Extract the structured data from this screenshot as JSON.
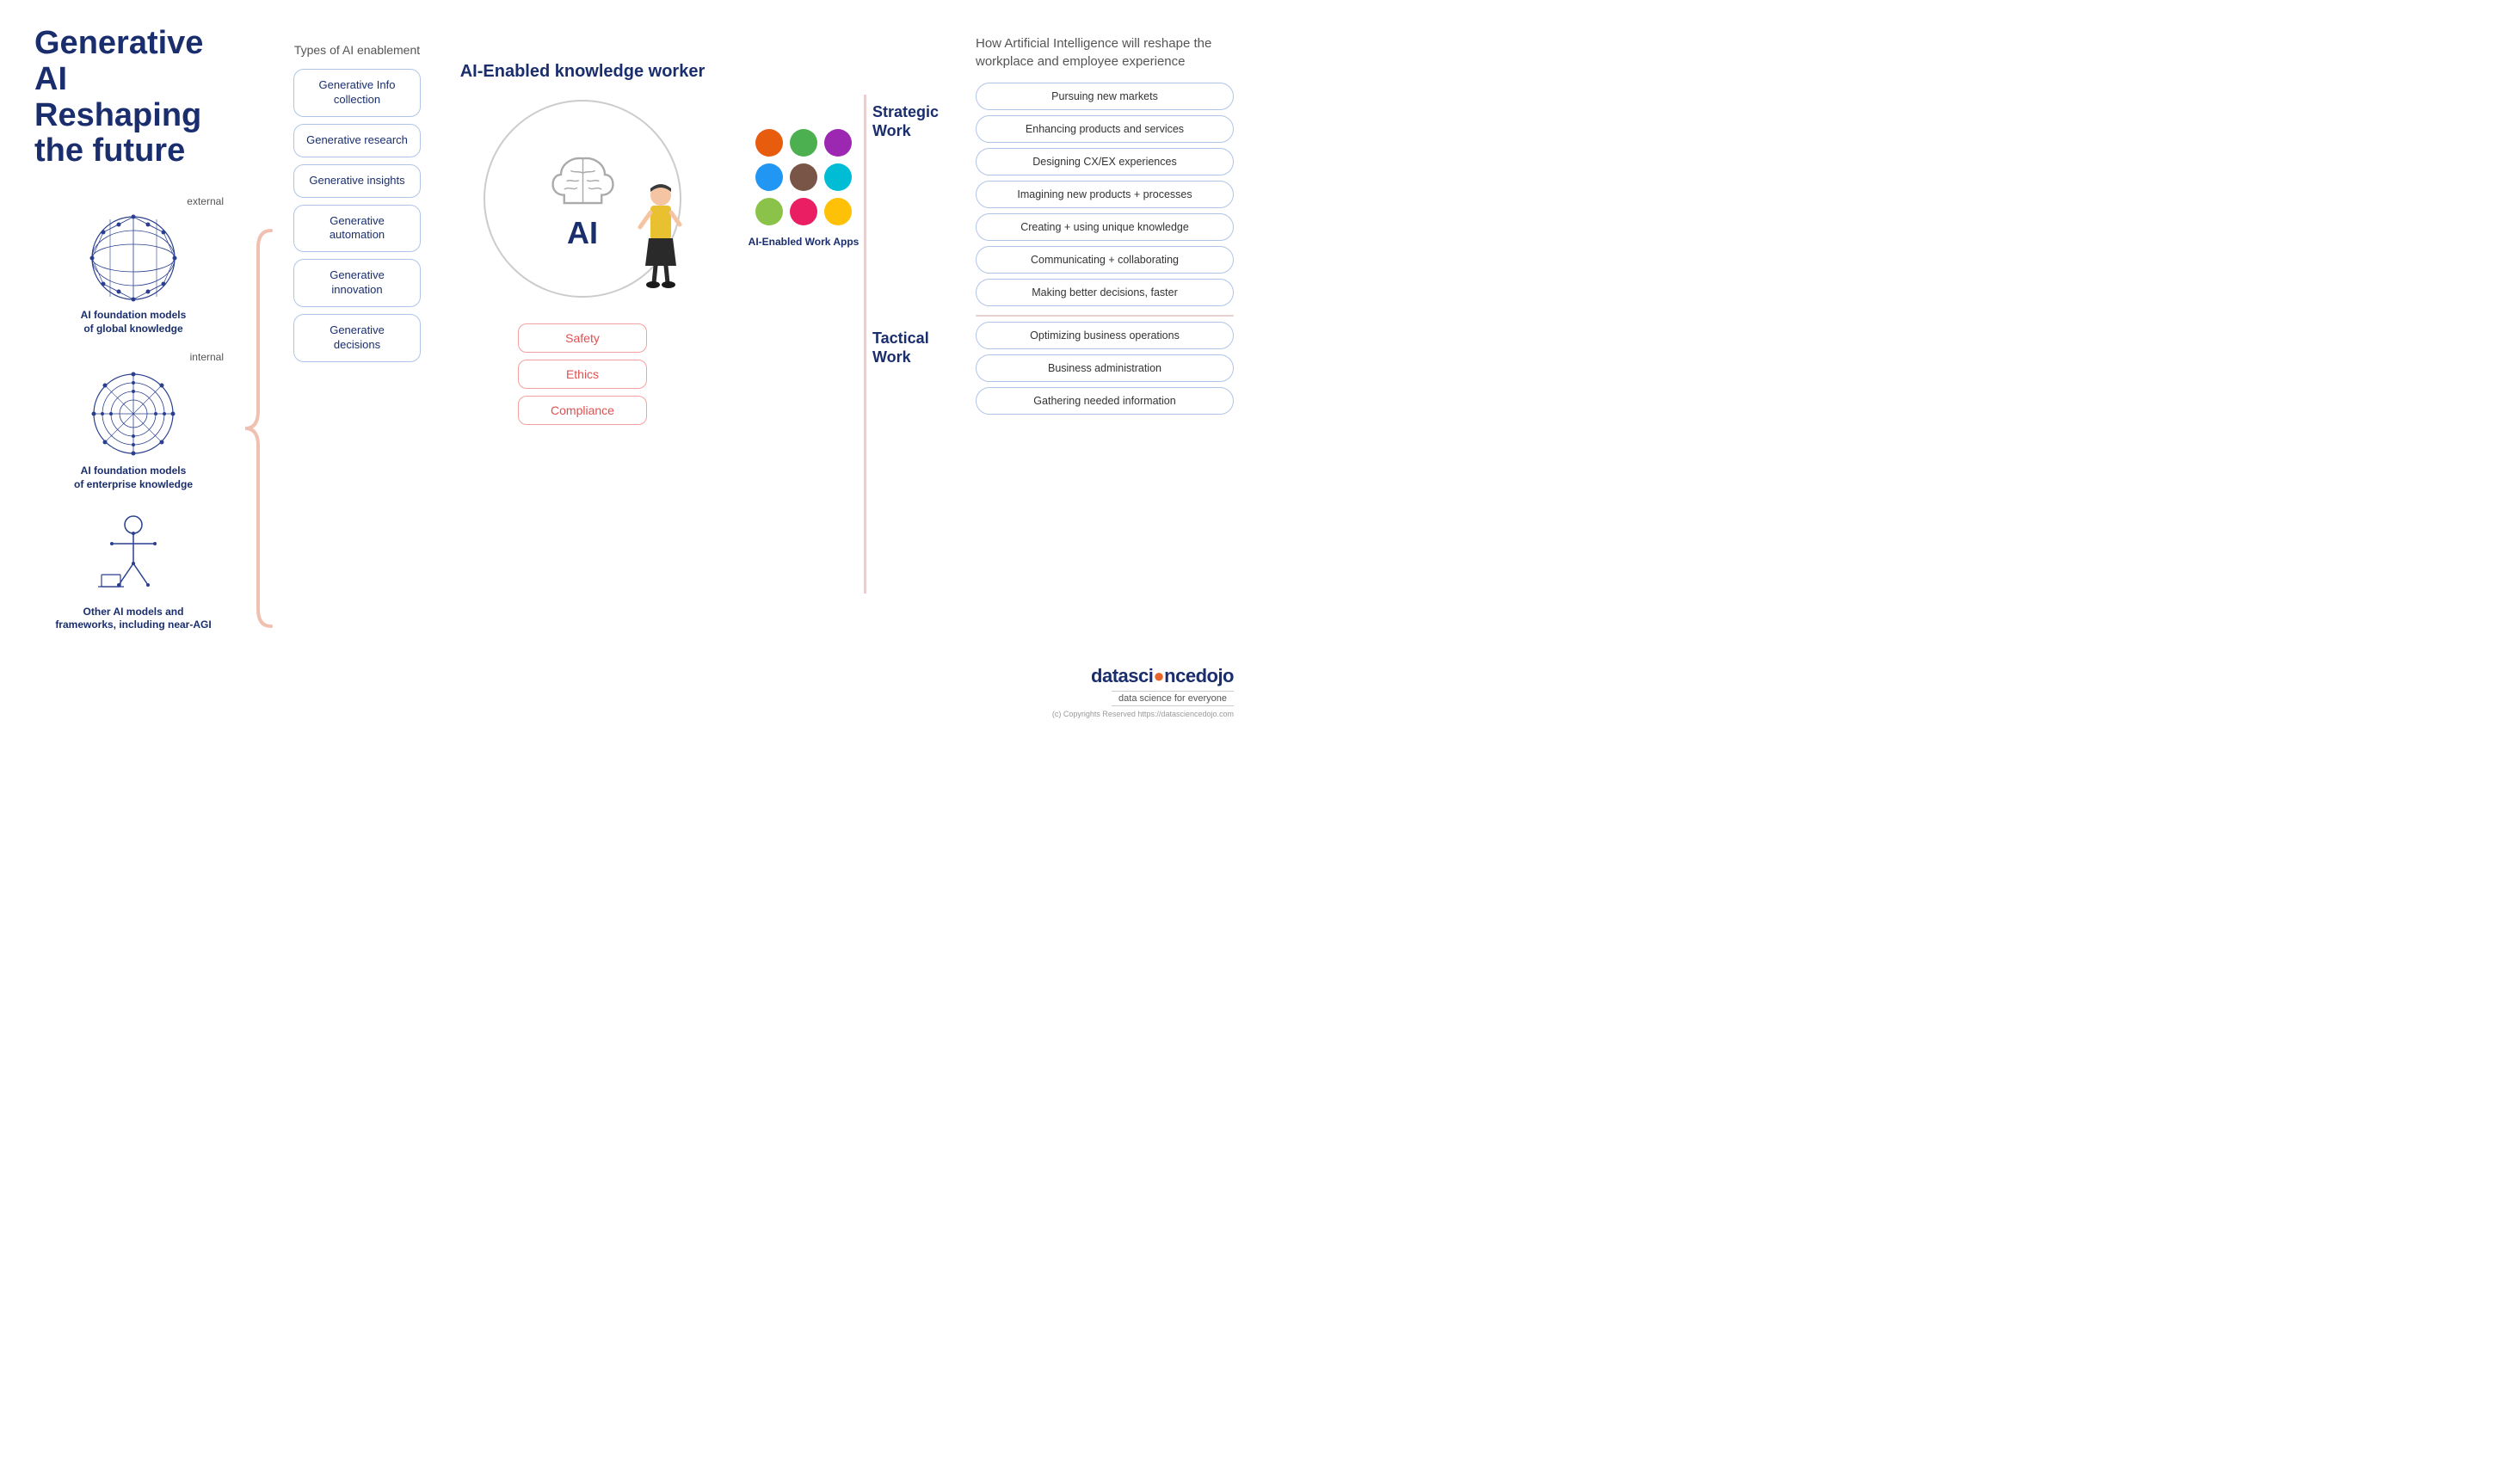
{
  "title": "Generative AI Reshaping the future",
  "left": {
    "models": [
      {
        "id": "external-globe",
        "label_side": "external",
        "caption": "AI foundation models of global knowledge"
      },
      {
        "id": "internal-globe",
        "label_side": "internal",
        "caption": "AI foundation models of enterprise knowledge"
      },
      {
        "id": "robot-figure",
        "label_side": "",
        "caption": "Other AI models and frameworks, including near-AGI"
      }
    ]
  },
  "types": {
    "section_title": "Types of AI enablement",
    "items": [
      "Generative Info collection",
      "Generative research",
      "Generative insights",
      "Generative automation",
      "Generative innovation",
      "Generative decisions"
    ]
  },
  "center": {
    "title": "AI-Enabled knowledge worker",
    "ai_label": "AI",
    "bottom_boxes": [
      "Safety",
      "Ethics",
      "Compliance"
    ]
  },
  "work_apps": {
    "dots": [
      {
        "color": "#e85c0d"
      },
      {
        "color": "#4caf50"
      },
      {
        "color": "#9c27b0"
      },
      {
        "color": "#2196f3"
      },
      {
        "color": "#795548"
      },
      {
        "color": "#00bcd4"
      },
      {
        "color": "#8bc34a"
      },
      {
        "color": "#e91e63"
      },
      {
        "color": "#ffc107"
      }
    ],
    "label": "AI-Enabled Work Apps"
  },
  "work_labels": {
    "strategic": "Strategic Work",
    "tactical": "Tactical Work"
  },
  "right": {
    "header": "How Artificial Intelligence will reshape the workplace and employee experience",
    "strategic_items": [
      "Pursuing new markets",
      "Enhancing products and services",
      "Designing CX/EX experiences",
      "Imagining new products + processes",
      "Creating + using unique knowledge",
      "Communicating + collaborating",
      "Making better decisions, faster"
    ],
    "tactical_items": [
      "Optimizing business operations",
      "Business administration",
      "Gathering needed information"
    ]
  },
  "logo": {
    "text_left": "datasci",
    "text_orange": "o",
    "text_right": "ncedojo",
    "tagline": "data science for everyone",
    "copyright": "(c) Copyrights Reserved  https://datasciencedojo.com"
  }
}
